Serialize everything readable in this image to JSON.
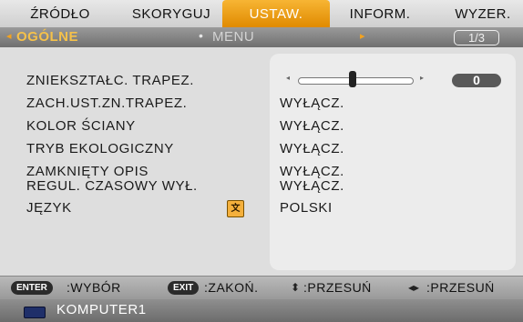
{
  "tabs": [
    {
      "label": "ŹRÓDŁO",
      "active": false
    },
    {
      "label": "SKORYGUJ",
      "active": false
    },
    {
      "label": "USTAW.",
      "active": true
    },
    {
      "label": "INFORM.",
      "active": false
    },
    {
      "label": "WYZER.",
      "active": false
    }
  ],
  "subbar": {
    "left_arrow": "◂",
    "general_label": "OGÓLNE",
    "dot": "•",
    "menu_label": "MENU",
    "right_arrow": "▸",
    "page_indicator": "1/3"
  },
  "settings": [
    {
      "label": "ZNIEKSZTAŁC. TRAPEZ.",
      "value": "0",
      "control": "slider",
      "level": 0.0
    },
    {
      "label": "ZACH.UST.ZN.TRAPEZ.",
      "value": "WYŁĄCZ."
    },
    {
      "label": "KOLOR ŚCIANY",
      "value": "WYŁĄCZ."
    },
    {
      "label": "TRYB EKOLOGICZNY",
      "value": "WYŁĄCZ."
    },
    {
      "label": "ZAMKNIĘTY OPIS",
      "value": "WYŁĄCZ."
    },
    {
      "label": "REGUL. CZASOWY WYŁ.",
      "value": "WYŁĄCZ."
    },
    {
      "label": "JĘZYK",
      "value": "POLSKI",
      "icon": "language-icon"
    }
  ],
  "slider": {
    "left_symbol": "◂",
    "right_symbol": "▸"
  },
  "helpbar": {
    "enter_key": "ENTER",
    "enter_text": ":WYBÓR",
    "exit_key": "EXIT",
    "exit_text": ":ZAKOŃ.",
    "updown_symbol": "⬍",
    "updown_text": ":PRZESUŃ",
    "leftright_symbol": "◂▸",
    "leftright_text": ":PRZESUŃ"
  },
  "status": {
    "source_icon": "monitor-icon",
    "source_name": "KOMPUTER1"
  },
  "colors": {
    "accent": "#F0A020",
    "active_tab_text": "#FFFFFF",
    "highlight_value_bg": "#595959"
  }
}
